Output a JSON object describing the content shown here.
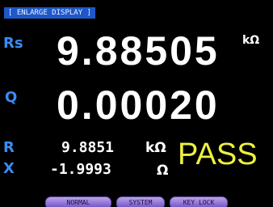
{
  "header": {
    "title": "[ ENLARGE DISPLAY ]"
  },
  "main": {
    "rs": {
      "label": "Rs",
      "value": "9.88505",
      "unit": "kΩ"
    },
    "q": {
      "label": "Q",
      "value": "0.00020"
    }
  },
  "sub": {
    "r": {
      "label": "R",
      "value": "9.8851",
      "unit": "kΩ"
    },
    "x": {
      "label": "X",
      "value": "-1.9993",
      "unit": "Ω"
    }
  },
  "judgment": {
    "text": "PASS"
  },
  "softkeys": {
    "normal": "NORMAL",
    "system": "SYSTEM",
    "key_lock": "KEY LOCK"
  },
  "colors": {
    "label": "#3a8cf4",
    "value": "#ffffff",
    "pass": "#eef23a",
    "header_bg": "#1e58c8"
  }
}
